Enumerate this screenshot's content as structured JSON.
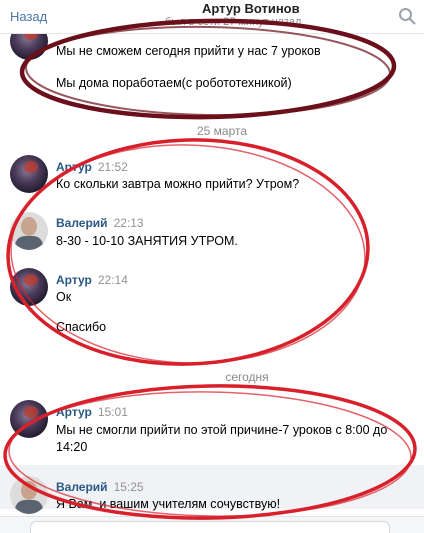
{
  "header": {
    "back_label": "Назад",
    "title": "Артур Вотинов",
    "status": "был в сети 27 минут назад"
  },
  "messages_top": [
    {
      "text": "Мы не сможем сегодня прийти у нас 7 уроков"
    },
    {
      "text": "Мы дома поработаем(с робототехникой)"
    }
  ],
  "date_1": "25 марта",
  "group_1": [
    {
      "author": "Артур",
      "time": "21:52",
      "lines": [
        "Ко скольки завтра можно прийти? Утром?"
      ]
    },
    {
      "author": "Валерий",
      "time": "22:13",
      "lines": [
        "8-30 - 10-10 ЗАНЯТИЯ УТРОМ."
      ]
    },
    {
      "author": "Артур",
      "time": "22:14",
      "lines": [
        "Ок",
        "Спасибо"
      ]
    }
  ],
  "date_2": "сегодня",
  "group_2": [
    {
      "author": "Артур",
      "time": "15:01",
      "lines": [
        "Мы не смогли прийти по этой причине-7 уроков с 8:00 до",
        "14:20"
      ]
    },
    {
      "author": "Валерий",
      "time": "15:25",
      "lines": [
        "Я Вам, и вашим учителям сочувствую!"
      ]
    }
  ],
  "colors": {
    "link": "#4a76a8",
    "author": "#2a5885",
    "annotation_dark": "#6b0f1a",
    "annotation_red": "#d8202b"
  }
}
